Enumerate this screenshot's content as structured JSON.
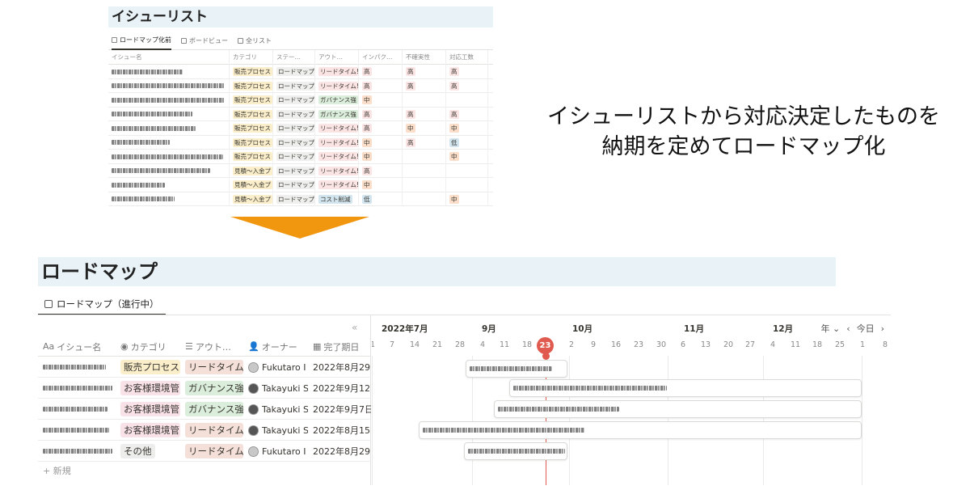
{
  "issue_list": {
    "title": "イシューリスト",
    "views": [
      "ロードマップ化前",
      "ボードビュー",
      "全リスト"
    ],
    "columns": [
      "イシュー名",
      "カテゴリ",
      "ステー…",
      "アウト…",
      "インパク…",
      "不確実性",
      "対応工数"
    ],
    "rows": [
      {
        "category": "販売プロセス",
        "status": "ロードマップ",
        "outcome": "リードタイム!",
        "impact": "高",
        "uncertainty": "高",
        "effort": "高"
      },
      {
        "category": "販売プロセス",
        "status": "ロードマップ",
        "outcome": "リードタイム!",
        "impact": "高",
        "uncertainty": "高",
        "effort": "高"
      },
      {
        "category": "販売プロセス",
        "status": "ロードマップ",
        "outcome": "ガバナンス強",
        "impact": "中",
        "uncertainty": "",
        "effort": ""
      },
      {
        "category": "販売プロセス",
        "status": "ロードマップ",
        "outcome": "ガバナンス強",
        "impact": "高",
        "uncertainty": "高",
        "effort": "高"
      },
      {
        "category": "販売プロセス",
        "status": "ロードマップ",
        "outcome": "リードタイム!",
        "impact": "高",
        "uncertainty": "中",
        "effort": "中"
      },
      {
        "category": "販売プロセス",
        "status": "ロードマップ",
        "outcome": "リードタイム!",
        "impact": "中",
        "uncertainty": "高",
        "effort": "低"
      },
      {
        "category": "販売プロセス",
        "status": "ロードマップ",
        "outcome": "リードタイム!",
        "impact": "中",
        "uncertainty": "",
        "effort": "中"
      },
      {
        "category": "見積〜入金プ",
        "status": "ロードマップ",
        "outcome": "リードタイム!",
        "impact": "高",
        "uncertainty": "",
        "effort": ""
      },
      {
        "category": "見積〜入金プ",
        "status": "ロードマップ",
        "outcome": "リードタイム!",
        "impact": "中",
        "uncertainty": "",
        "effort": ""
      },
      {
        "category": "見積〜入金プ",
        "status": "ロードマップ",
        "outcome": "コスト削減",
        "impact": "低",
        "uncertainty": "",
        "effort": "中"
      }
    ]
  },
  "caption": {
    "line1": "イシューリストから対応決定したものを",
    "line2": "納期を定めてロードマップ化"
  },
  "roadmap": {
    "title": "ロードマップ",
    "tab_label": "ロードマップ（進行中）",
    "collapse_glyph": "«",
    "columns": [
      "イシュー名",
      "カテゴリ",
      "アウト…",
      "オーナー",
      "完了期日"
    ],
    "rows": [
      {
        "category": "販売プロセス",
        "outcome": "リードタイム!",
        "owner": "Fukutaro I",
        "due": "2022年8月29日"
      },
      {
        "category": "お客様環境管",
        "outcome": "ガバナンス強",
        "owner": "Takayuki S",
        "due": "2022年9月12日"
      },
      {
        "category": "お客様環境管",
        "outcome": "ガバナンス強",
        "owner": "Takayuki S",
        "due": "2022年9月7日"
      },
      {
        "category": "お客様環境管",
        "outcome": "リードタイム!",
        "owner": "Takayuki S",
        "due": "2022年8月15日"
      },
      {
        "category": "その他",
        "outcome": "リードタイム!",
        "owner": "Fukutaro I",
        "due": "2022年8月29日"
      }
    ],
    "new_label": "+ 新規",
    "timeline": {
      "months": [
        "2022年7月",
        "9月",
        "10月",
        "11月",
        "12月"
      ],
      "days": [
        "1",
        "7",
        "14",
        "21",
        "28",
        "4",
        "11",
        "18",
        "23",
        "2",
        "9",
        "16",
        "23",
        "30",
        "6",
        "13",
        "20",
        "27",
        "4",
        "11",
        "18",
        "25",
        "1",
        "8"
      ],
      "today": "23",
      "controls": {
        "period": "年",
        "today_label": "今日"
      }
    }
  },
  "colors": {
    "title_band": "#e8f2f7",
    "arrow": "#f0960f",
    "today": "#e05a4f"
  }
}
